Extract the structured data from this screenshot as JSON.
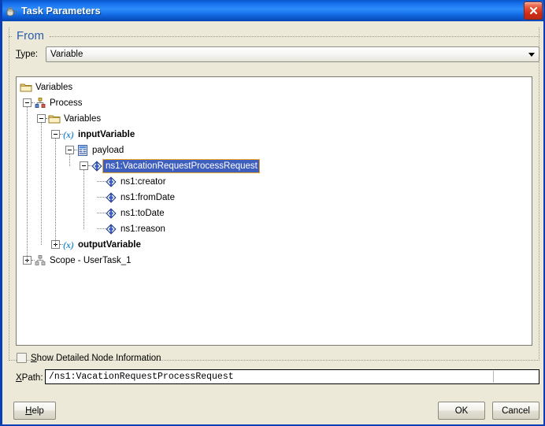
{
  "window": {
    "title": "Task Parameters",
    "icon": "java-coffee-cup-icon",
    "close_label": "×"
  },
  "group": {
    "title": "From"
  },
  "type_row": {
    "label_prefix": "T",
    "label_rest": "ype:",
    "selected_value": "Variable",
    "options": [
      "Variable"
    ]
  },
  "tree": {
    "nodes": [
      {
        "label": "Variables",
        "icon": "folder-icon",
        "depth": 0,
        "expander": "none",
        "bold": false,
        "selected": false
      },
      {
        "label": "Process",
        "icon": "process-icon",
        "depth": 1,
        "expander": "minus",
        "bold": false,
        "selected": false
      },
      {
        "label": "Variables",
        "icon": "folder-icon",
        "depth": 2,
        "expander": "minus",
        "bold": false,
        "selected": false
      },
      {
        "label": "inputVariable",
        "icon": "variable-x-icon",
        "depth": 3,
        "expander": "minus",
        "bold": true,
        "selected": false
      },
      {
        "label": "payload",
        "icon": "payload-icon",
        "depth": 4,
        "expander": "minus",
        "bold": false,
        "selected": false
      },
      {
        "label": "ns1:VacationRequestProcessRequest",
        "icon": "element-icon",
        "depth": 5,
        "expander": "minus",
        "bold": false,
        "selected": true
      },
      {
        "label": "ns1:creator",
        "icon": "element-icon",
        "depth": 6,
        "expander": "none",
        "bold": false,
        "selected": false
      },
      {
        "label": "ns1:fromDate",
        "icon": "element-icon",
        "depth": 6,
        "expander": "none",
        "bold": false,
        "selected": false
      },
      {
        "label": "ns1:toDate",
        "icon": "element-icon",
        "depth": 6,
        "expander": "none",
        "bold": false,
        "selected": false
      },
      {
        "label": "ns1:reason",
        "icon": "element-icon",
        "depth": 6,
        "expander": "none",
        "bold": false,
        "selected": false
      },
      {
        "label": "outputVariable",
        "icon": "variable-x-icon",
        "depth": 3,
        "expander": "plus",
        "bold": true,
        "selected": false
      },
      {
        "label": "Scope - UserTask_1",
        "icon": "scope-icon",
        "depth": 1,
        "expander": "plus",
        "bold": false,
        "selected": false
      }
    ]
  },
  "detail_checkbox": {
    "checked": false,
    "label_prefix": "S",
    "label_rest": "how Detailed Node Information"
  },
  "xpath": {
    "label_prefix": "X",
    "label_rest": "Path:",
    "value": "/ns1:VacationRequestProcessRequest"
  },
  "buttons": {
    "help_prefix": "H",
    "help_rest": "elp",
    "ok": "OK",
    "cancel": "Cancel"
  },
  "colors": {
    "titlebar_blue": "#1b76ef",
    "window_border": "#0b3fb5",
    "group_title": "#2a5caa",
    "selection_bg": "#3f5fbf",
    "selection_border": "#f0a828",
    "dialog_bg": "#ece9d8",
    "close_red": "#cf2a12"
  }
}
